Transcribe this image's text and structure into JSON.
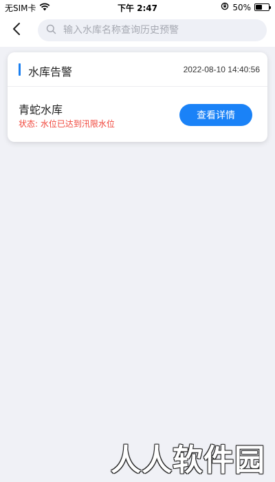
{
  "status_bar": {
    "carrier": "无SIM卡",
    "time": "下午 2:47",
    "battery": "50%",
    "battery_level": 0.5
  },
  "header": {
    "search": {
      "placeholder": "输入水库名称查询历史预警"
    }
  },
  "alerts": [
    {
      "title": "水库告警",
      "time": "2022-08-10 14:40:56",
      "reservoir": "青蛇水库",
      "status": "状态: 水位已达到汛限水位",
      "action_label": "查看详情"
    }
  ],
  "colors": {
    "accent": "#1a7ff0",
    "button": "#1a82f7",
    "status_alert": "#f0453a",
    "background": "#f0f1f6"
  },
  "icons": [
    "wifi-icon",
    "back-icon",
    "search-icon",
    "orientation-lock-icon",
    "battery-icon"
  ],
  "watermark": "人人软件园"
}
